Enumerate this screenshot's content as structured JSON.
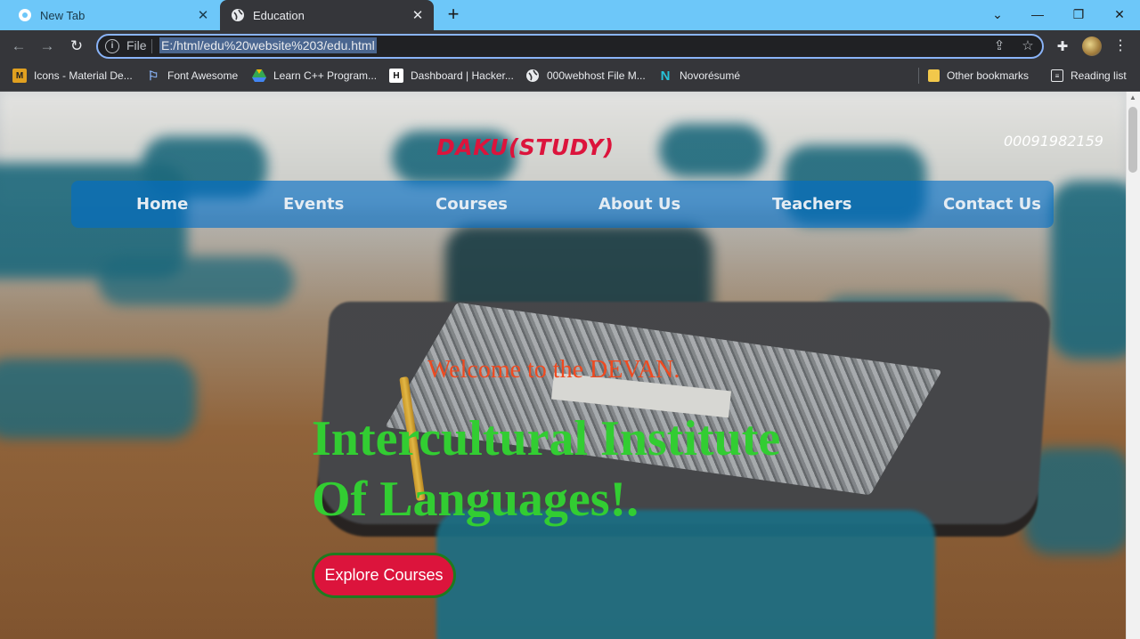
{
  "browser": {
    "tabs": [
      {
        "title": "New Tab",
        "icon": "chrome-icon",
        "active": false
      },
      {
        "title": "Education",
        "icon": "globe-icon",
        "active": true
      }
    ],
    "new_tab_label": "+",
    "address": {
      "scheme_label": "File",
      "url": "E:/html/edu%20website%203/edu.html"
    },
    "bookmarks": [
      {
        "label": "Icons - Material De...",
        "icon": "material-icon",
        "color": "#e0a020"
      },
      {
        "label": "Font Awesome",
        "icon": "flag-icon",
        "color": "#8ab4f8"
      },
      {
        "label": "Learn C++ Program...",
        "icon": "drive-icon",
        "color": "#34a853"
      },
      {
        "label": "Dashboard | Hacker...",
        "icon": "hackerrank-icon",
        "color": "#ffffff"
      },
      {
        "label": "000webhost File M...",
        "icon": "globe-icon",
        "color": "#e8eaed"
      },
      {
        "label": "Novorésumé",
        "icon": "novoresume-icon",
        "color": "#27c2d9"
      }
    ],
    "other_bookmarks": "Other bookmarks",
    "reading_list": "Reading list"
  },
  "site": {
    "brand": "DAKU(STUDY)",
    "phone": "00091982159",
    "nav": [
      "Home",
      "Events",
      "Courses",
      "About Us",
      "Teachers",
      "Contact Us"
    ],
    "welcome": "Welcome to the DEVAN.",
    "headline_line1": "Intercultural Institute",
    "headline_line2": "Of Languages!.",
    "cta_label": "Explore Courses"
  },
  "colors": {
    "brand": "#dc143c",
    "headline": "#32cd32",
    "welcome": "#ef4a20",
    "navbar": "#006ec8",
    "cta_bg": "#dc143c",
    "cta_border": "#1f7a1f"
  }
}
